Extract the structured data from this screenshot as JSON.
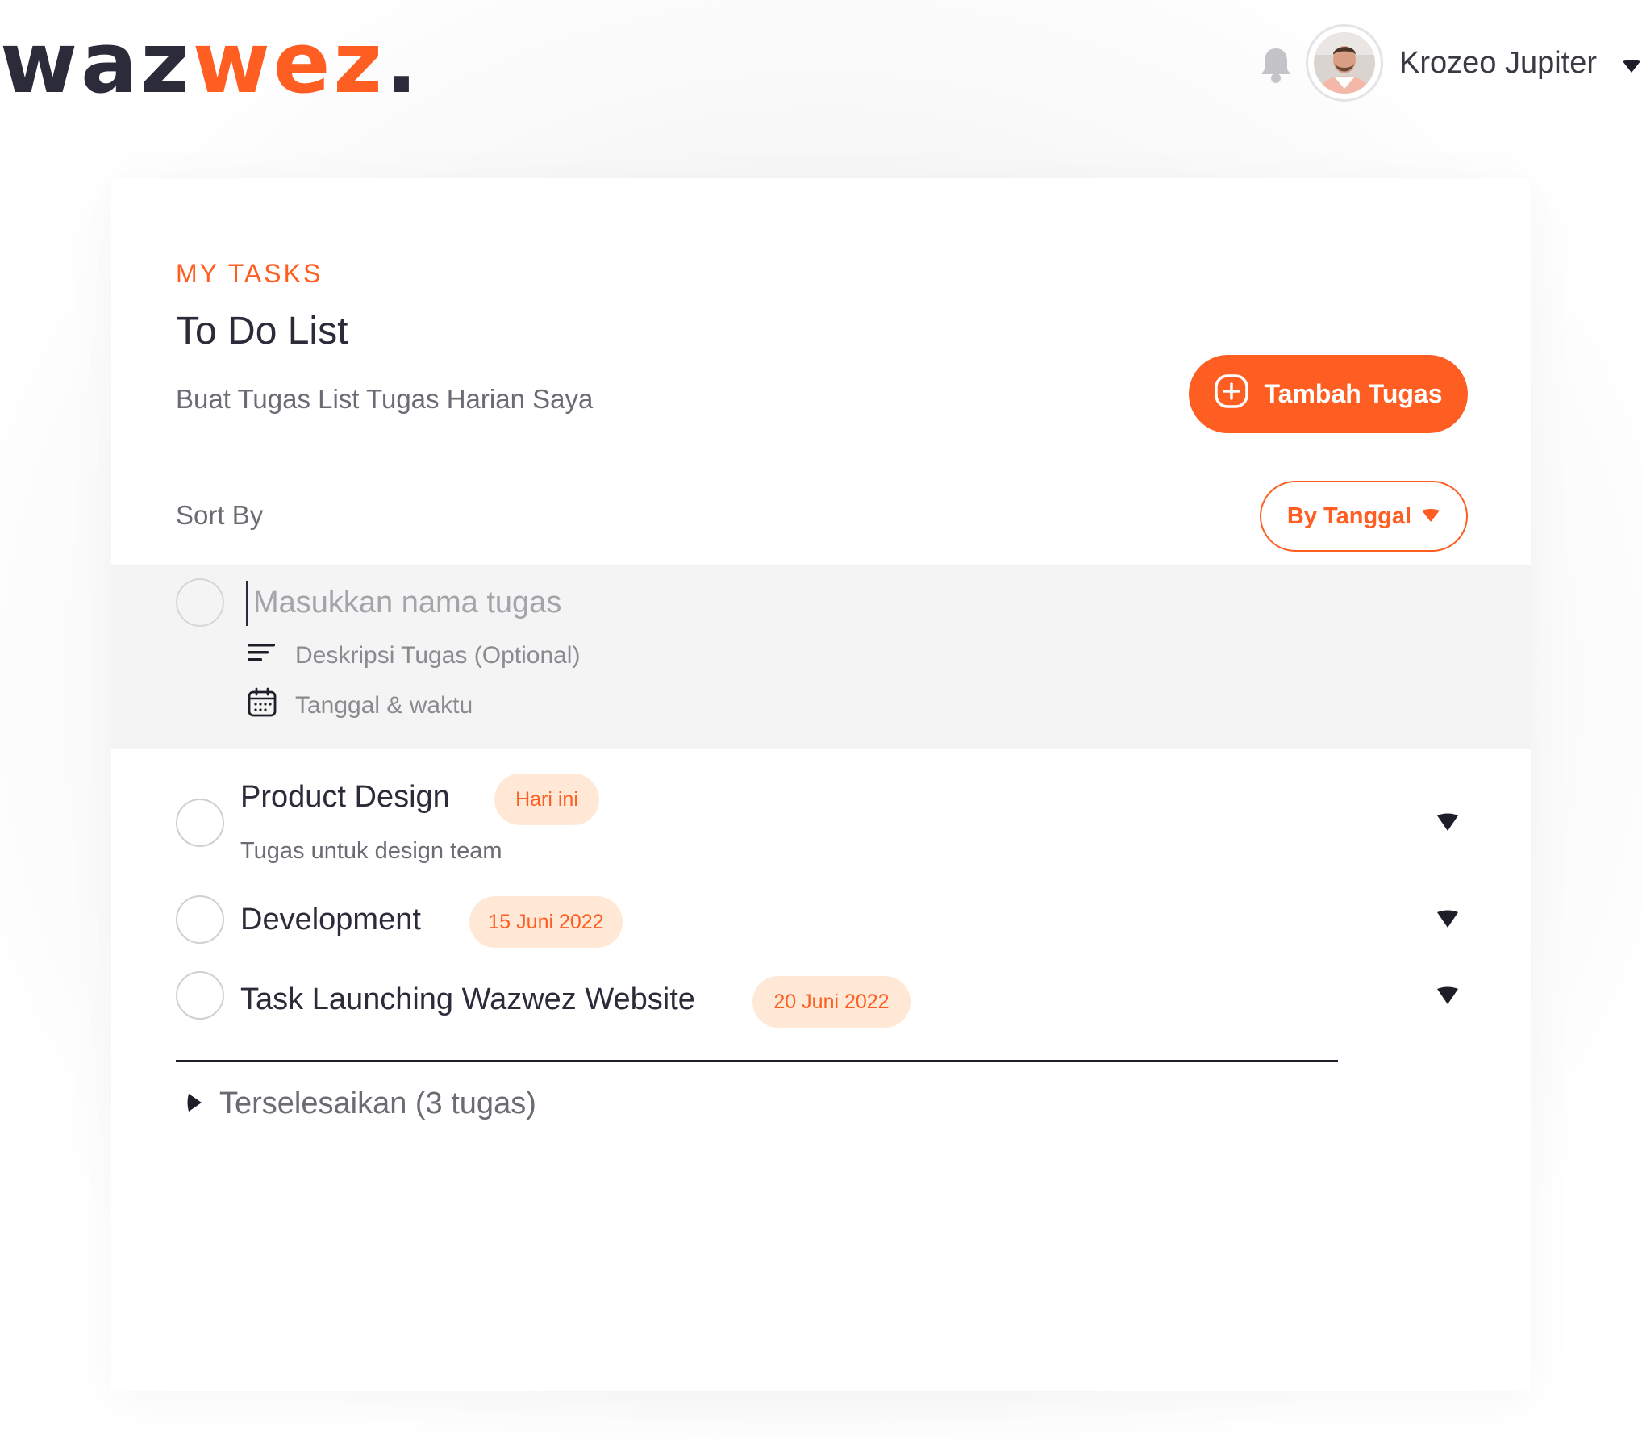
{
  "brand": {
    "part1": "waz",
    "part2": "wez",
    "dot": ".",
    "accent": "#ff5e22",
    "dark": "#2b2b3a"
  },
  "header": {
    "bell_icon": "bell-icon",
    "user_name": "Krozeo Jupiter",
    "caret_icon": "caret-down-icon"
  },
  "page": {
    "eyebrow": "MY TASKS",
    "title": "To Do List",
    "subtitle": "Buat Tugas List Tugas Harian Saya",
    "add_button": "Tambah Tugas",
    "sort_label": "Sort By",
    "sort_value": "By Tanggal"
  },
  "new_task": {
    "name_placeholder": "Masukkan nama tugas",
    "description_placeholder": "Deskripsi Tugas (Optional)",
    "date_placeholder": "Tanggal & waktu"
  },
  "tasks": [
    {
      "name": "Product Design",
      "badge": "Hari ini",
      "description": "Tugas untuk design team"
    },
    {
      "name": "Development",
      "badge": "15 Juni 2022"
    },
    {
      "name": "Task Launching Wazwez Website",
      "badge": "20 Juni 2022"
    }
  ],
  "completed_section": {
    "label": "Terselesaikan (3 tugas)"
  }
}
